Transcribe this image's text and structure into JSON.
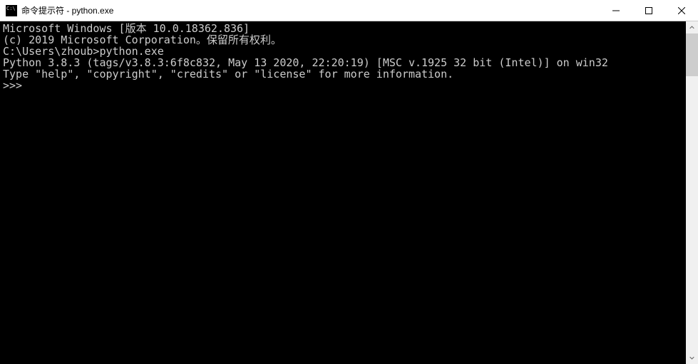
{
  "window": {
    "title": "命令提示符 - python.exe"
  },
  "console": {
    "line1": "Microsoft Windows [版本 10.0.18362.836]",
    "line2": "(c) 2019 Microsoft Corporation。保留所有权利。",
    "line3": "",
    "line4": "C:\\Users\\zhoub>python.exe",
    "line5": "Python 3.8.3 (tags/v3.8.3:6f8c832, May 13 2020, 22:20:19) [MSC v.1925 32 bit (Intel)] on win32",
    "line6": "Type \"help\", \"copyright\", \"credits\" or \"license\" for more information.",
    "line7": ">>>"
  }
}
